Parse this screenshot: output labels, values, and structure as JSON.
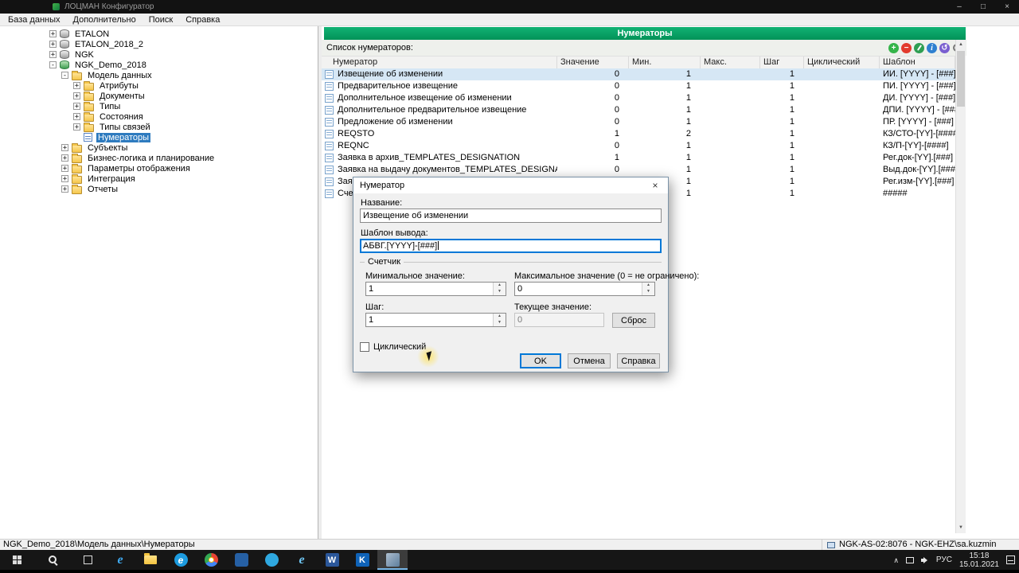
{
  "colors": {
    "green": "#05A264",
    "sel": "#2E7BBF",
    "rowsel": "#D6E7F5",
    "focus": "#0078D7"
  },
  "window": {
    "title": "ЛОЦМАН Конфигуратор",
    "minimize_glyph": "–",
    "maximize_glyph": "□",
    "close_glyph": "×"
  },
  "menu": {
    "items": [
      {
        "label": "База данных",
        "key": "database"
      },
      {
        "label": "Дополнительно",
        "key": "extra"
      },
      {
        "label": "Поиск",
        "key": "search"
      },
      {
        "label": "Справка",
        "key": "help"
      }
    ]
  },
  "tree": {
    "items": [
      {
        "label": "ETALON",
        "level": 0,
        "exp": "+",
        "icon": "db"
      },
      {
        "label": "ETALON_2018_2",
        "level": 0,
        "exp": "+",
        "icon": "db"
      },
      {
        "label": "NGK",
        "level": 0,
        "exp": "+",
        "icon": "db"
      },
      {
        "label": "NGK_Demo_2018",
        "level": 0,
        "exp": "-",
        "icon": "dbg"
      },
      {
        "label": "Модель данных",
        "level": 1,
        "exp": "-",
        "icon": "folder"
      },
      {
        "label": "Атрибуты",
        "level": 2,
        "exp": "+",
        "icon": "folder"
      },
      {
        "label": "Документы",
        "level": 2,
        "exp": "+",
        "icon": "folder"
      },
      {
        "label": "Типы",
        "level": 2,
        "exp": "+",
        "icon": "folder"
      },
      {
        "label": "Состояния",
        "level": 2,
        "exp": "+",
        "icon": "folder"
      },
      {
        "label": "Типы связей",
        "level": 2,
        "exp": "+",
        "icon": "folder"
      },
      {
        "label": "Нумераторы",
        "level": 2,
        "exp": "",
        "icon": "numgrid",
        "selected": true
      },
      {
        "label": "Субъекты",
        "level": 1,
        "exp": "+",
        "icon": "folder"
      },
      {
        "label": "Бизнес-логика и планирование",
        "level": 1,
        "exp": "+",
        "icon": "folder"
      },
      {
        "label": "Параметры отображения",
        "level": 1,
        "exp": "+",
        "icon": "folder"
      },
      {
        "label": "Интеграция",
        "level": 1,
        "exp": "+",
        "icon": "folder"
      },
      {
        "label": "Отчеты",
        "level": 1,
        "exp": "+",
        "icon": "folder"
      }
    ]
  },
  "content": {
    "header": "Нумераторы",
    "list_label": "Список нумераторов:",
    "toolbar": [
      {
        "name": "add-button",
        "key": "add",
        "glyph": "+",
        "color": "#35B44A"
      },
      {
        "name": "delete-button",
        "key": "del",
        "glyph": "−",
        "color": "#E23B2E"
      },
      {
        "name": "edit-button",
        "key": "edit",
        "glyph": "",
        "color": "#2E9E52"
      },
      {
        "name": "info-button",
        "key": "info",
        "glyph": "i",
        "color": "#2F80D0"
      },
      {
        "name": "refresh-button",
        "key": "refresh",
        "glyph": "↺",
        "color": "#7A5FD0"
      },
      {
        "name": "search-button",
        "key": "search",
        "glyph": "",
        "color": ""
      }
    ],
    "table": {
      "columns": [
        "Нумератор",
        "Значение",
        "Мин.",
        "Макс.",
        "Шаг",
        "Циклический",
        "Шаблон"
      ],
      "rows": [
        {
          "name": "Извещение об изменении",
          "value": "0",
          "min": "1",
          "max": "",
          "step": "1",
          "cyclic": "",
          "template": "ИИ. [YYYY] - [###]",
          "selected": true
        },
        {
          "name": "Предварительное извещение",
          "value": "0",
          "min": "1",
          "max": "",
          "step": "1",
          "cyclic": "",
          "template": "ПИ. [YYYY] - [###]"
        },
        {
          "name": "Дополнительное извещение об изменении",
          "value": "0",
          "min": "1",
          "max": "",
          "step": "1",
          "cyclic": "",
          "template": "ДИ. [YYYY] - [###]"
        },
        {
          "name": "Дополнительное предварительное извещение",
          "value": "0",
          "min": "1",
          "max": "",
          "step": "1",
          "cyclic": "",
          "template": "ДПИ. [YYYY] - [###]"
        },
        {
          "name": "Предложение об изменении",
          "value": "0",
          "min": "1",
          "max": "",
          "step": "1",
          "cyclic": "",
          "template": "ПР. [YYYY] - [###]"
        },
        {
          "name": "REQSTO",
          "value": "1",
          "min": "2",
          "max": "",
          "step": "1",
          "cyclic": "",
          "template": "КЗ/СТО-[YY]-[####]"
        },
        {
          "name": "REQNC",
          "value": "0",
          "min": "1",
          "max": "",
          "step": "1",
          "cyclic": "",
          "template": "КЗ/П-[YY]-[####]"
        },
        {
          "name": "Заявка в архив_TEMPLATES_DESIGNATION",
          "value": "1",
          "min": "1",
          "max": "",
          "step": "1",
          "cyclic": "",
          "template": "Рег.док-[YY].[###]"
        },
        {
          "name": "Заявка на выдачу документов_TEMPLATES_DESIGNATION",
          "value": "0",
          "min": "1",
          "max": "",
          "step": "1",
          "cyclic": "",
          "template": "Выд.док-[YY].[###]"
        },
        {
          "name": "Зая",
          "value": "",
          "min": "1",
          "max": "",
          "step": "1",
          "cyclic": "",
          "template": "Рег.изм-[YY].[###]"
        },
        {
          "name": "Счет",
          "value": "",
          "min": "1",
          "max": "",
          "step": "1",
          "cyclic": "",
          "template": "#####"
        }
      ]
    }
  },
  "dialog": {
    "title": "Нумератор",
    "close_glyph": "×",
    "name_label": "Название:",
    "name_value": "Извещение об изменении",
    "template_label": "Шаблон вывода:",
    "template_value": "АБВГ.[YYYY]-[###]",
    "counter_group": "Счетчик",
    "min_label": "Минимальное значение:",
    "min_value": "1",
    "max_label": "Максимальное значение (0 = не ограничено):",
    "max_value": "0",
    "step_label": "Шаг:",
    "step_value": "1",
    "current_label": "Текущее значение:",
    "current_value": "0",
    "reset_button": "Сброс",
    "cyclic_label": "Циклический",
    "ok_button": "OK",
    "cancel_button": "Отмена",
    "help_button": "Справка"
  },
  "statusbar": {
    "path": "NGK_Demo_2018\\Модель данных\\Нумераторы",
    "connection": "NGK-AS-02:8076 - NGK-EHZ\\sa.kuzmin"
  },
  "taskbar": {
    "apps": [
      {
        "name": "taskbar-app-ie",
        "style": "ie",
        "glyph": "e"
      },
      {
        "name": "taskbar-app-file-explorer",
        "style": "explorer",
        "glyph": ""
      },
      {
        "name": "taskbar-app-edge",
        "style": "edge",
        "glyph": "e"
      },
      {
        "name": "taskbar-app-chrome",
        "style": "chrome",
        "glyph": ""
      },
      {
        "name": "taskbar-app-blue-1",
        "style": "blue1",
        "glyph": ""
      },
      {
        "name": "taskbar-app-blue-2",
        "style": "blue2",
        "glyph": ""
      },
      {
        "name": "taskbar-app-ie-2",
        "style": "ie2",
        "glyph": "e"
      },
      {
        "name": "taskbar-app-word",
        "style": "word",
        "glyph": "W"
      },
      {
        "name": "taskbar-app-kompas",
        "style": "kompas",
        "glyph": "K"
      },
      {
        "name": "taskbar-app-lotsman",
        "style": "lotsman",
        "glyph": "",
        "active": true
      }
    ],
    "tray": {
      "lang": "РУС",
      "time": "15:18",
      "date": "15.01.2021"
    }
  }
}
